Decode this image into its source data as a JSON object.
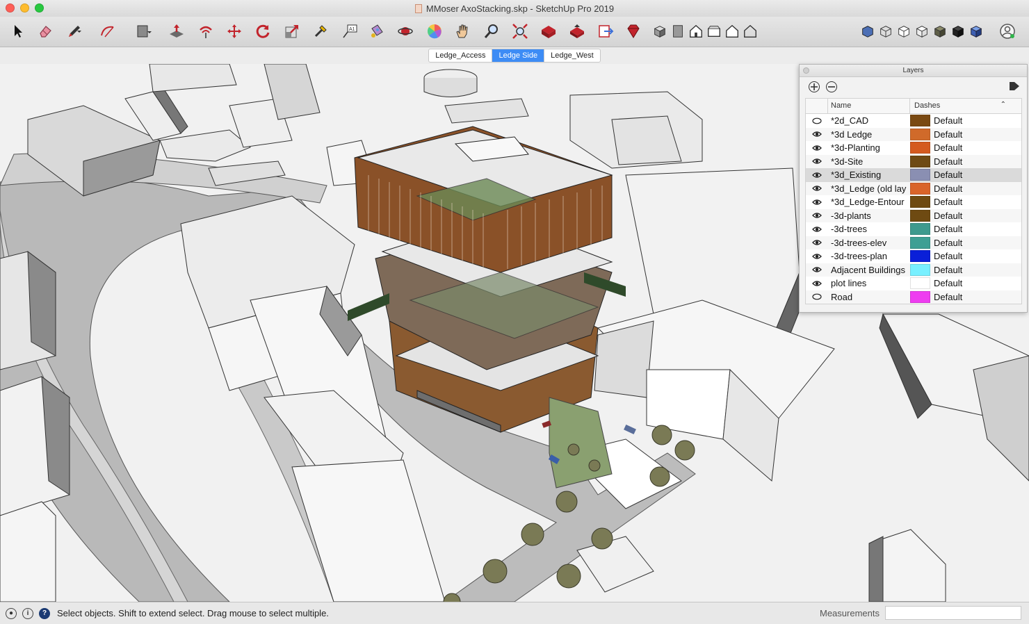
{
  "window": {
    "title": "MMoser AxoStacking.skp - SketchUp Pro 2019"
  },
  "toolbar": {
    "tools": [
      {
        "name": "select-tool",
        "icon": "arrow-icon"
      },
      {
        "name": "eraser-tool",
        "icon": "eraser-icon"
      },
      {
        "name": "line-tool",
        "icon": "pencil-icon"
      },
      {
        "name": "arc-tool",
        "icon": "arc-icon"
      },
      {
        "name": "rectangle-tool",
        "icon": "rectangle-icon"
      },
      {
        "name": "push-pull-tool",
        "icon": "push-pull-icon"
      },
      {
        "name": "offset-tool",
        "icon": "offset-icon"
      },
      {
        "name": "move-tool",
        "icon": "move-icon"
      },
      {
        "name": "rotate-tool",
        "icon": "rotate-icon"
      },
      {
        "name": "scale-tool",
        "icon": "scale-icon"
      },
      {
        "name": "tape-measure-tool",
        "icon": "tape-icon"
      },
      {
        "name": "text-tool",
        "icon": "text-icon"
      },
      {
        "name": "paint-bucket-tool",
        "icon": "paint-bucket-icon"
      },
      {
        "name": "orbit-tool",
        "icon": "orbit-icon"
      },
      {
        "name": "colors-tool",
        "icon": "color-wheel-icon"
      },
      {
        "name": "pan-tool",
        "icon": "hand-icon"
      },
      {
        "name": "zoom-tool",
        "icon": "magnifier-icon"
      },
      {
        "name": "zoom-extents-tool",
        "icon": "zoom-extents-icon"
      },
      {
        "name": "warehouse-tool",
        "icon": "warehouse-icon"
      },
      {
        "name": "share-model-tool",
        "icon": "share-icon"
      },
      {
        "name": "send-layout-tool",
        "icon": "layout-icon"
      },
      {
        "name": "extension-warehouse-tool",
        "icon": "ruby-icon"
      },
      {
        "name": "iso-view",
        "icon": "iso-icon"
      },
      {
        "name": "top-view",
        "icon": "top-icon"
      },
      {
        "name": "front-view",
        "icon": "house-front-icon"
      },
      {
        "name": "right-view",
        "icon": "right-icon"
      },
      {
        "name": "back-view",
        "icon": "house-outline-icon"
      },
      {
        "name": "style-xray",
        "icon": "xray-icon"
      },
      {
        "name": "style-wireframe",
        "icon": "wireframe-icon"
      },
      {
        "name": "style-hidden-line",
        "icon": "hidden-line-icon"
      },
      {
        "name": "style-shaded",
        "icon": "shaded-icon"
      },
      {
        "name": "style-textured",
        "icon": "textured-icon"
      },
      {
        "name": "style-monochrome",
        "icon": "monochrome-icon"
      },
      {
        "name": "style-color",
        "icon": "color-style-icon"
      },
      {
        "name": "account",
        "icon": "user-icon"
      }
    ]
  },
  "scenes": {
    "tabs": [
      {
        "label": "Ledge_Access",
        "active": false
      },
      {
        "label": "Ledge Side",
        "active": true
      },
      {
        "label": "Ledge_West",
        "active": false
      }
    ]
  },
  "layers_panel": {
    "title": "Layers",
    "columns": {
      "name": "Name",
      "dashes": "Dashes"
    },
    "rows": [
      {
        "name": "*2d_CAD",
        "visible": false,
        "color": "#7a4a12",
        "dashes": "Default"
      },
      {
        "name": "*3d Ledge",
        "visible": true,
        "color": "#d06a2a",
        "dashes": "Default"
      },
      {
        "name": "*3d-Planting",
        "visible": true,
        "color": "#d45a1f",
        "dashes": "Default"
      },
      {
        "name": "*3d-Site",
        "visible": true,
        "color": "#6e4a14",
        "dashes": "Default"
      },
      {
        "name": "*3d_Existing",
        "visible": true,
        "color": "#8a8fb2",
        "dashes": "Default",
        "selected": true
      },
      {
        "name": "*3d_Ledge (old lay",
        "visible": true,
        "color": "#d9642a",
        "dashes": "Default"
      },
      {
        "name": "*3d_Ledge-Entour",
        "visible": true,
        "color": "#6e4a12",
        "dashes": "Default"
      },
      {
        "name": "-3d-plants",
        "visible": true,
        "color": "#6e4a12",
        "dashes": "Default"
      },
      {
        "name": "-3d-trees",
        "visible": true,
        "color": "#3e9a8e",
        "dashes": "Default"
      },
      {
        "name": "-3d-trees-elev",
        "visible": true,
        "color": "#3e9f94",
        "dashes": "Default"
      },
      {
        "name": "-3d-trees-plan",
        "visible": true,
        "color": "#0a1fd8",
        "dashes": "Default"
      },
      {
        "name": "Adjacent Buildings",
        "visible": true,
        "color": "#78f0ff",
        "dashes": "Default"
      },
      {
        "name": "plot lines",
        "visible": true,
        "color": "#ffffff",
        "dashes": "Default"
      },
      {
        "name": "Road",
        "visible": false,
        "color": "#ee3df0",
        "dashes": "Default"
      }
    ]
  },
  "statusbar": {
    "message": "Select objects. Shift to extend select. Drag mouse to select multiple.",
    "measurements_label": "Measurements",
    "measurements_value": ""
  }
}
